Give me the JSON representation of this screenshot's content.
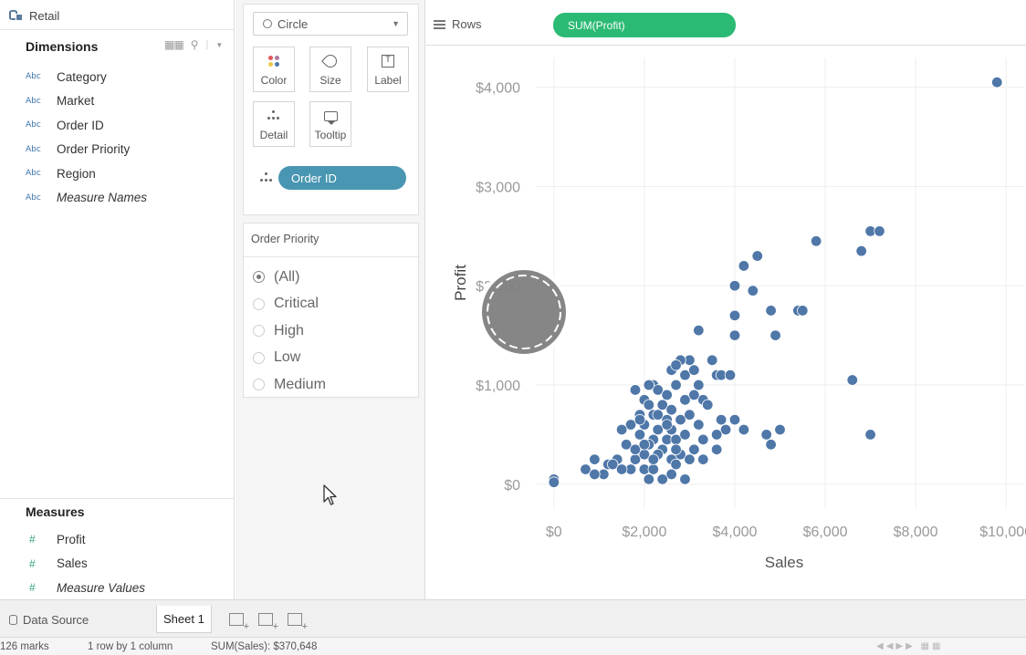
{
  "data_pane": {
    "datasource": "Retail",
    "dimensions_title": "Dimensions",
    "dimensions": [
      {
        "type": "Abc",
        "name": "Category",
        "italic": false
      },
      {
        "type": "Abc",
        "name": "Market",
        "italic": false
      },
      {
        "type": "Abc",
        "name": "Order ID",
        "italic": false
      },
      {
        "type": "Abc",
        "name": "Order Priority",
        "italic": false
      },
      {
        "type": "Abc",
        "name": "Region",
        "italic": false
      },
      {
        "type": "Abc",
        "name": "Measure Names",
        "italic": true
      }
    ],
    "measures_title": "Measures",
    "measures": [
      {
        "type": "#",
        "name": "Profit",
        "italic": false
      },
      {
        "type": "#",
        "name": "Sales",
        "italic": false
      },
      {
        "type": "#",
        "name": "Measure Values",
        "italic": true
      }
    ]
  },
  "marks": {
    "mark_type": "Circle",
    "buttons": {
      "color": "Color",
      "size": "Size",
      "label": "Label",
      "detail": "Detail",
      "tooltip": "Tooltip"
    },
    "label_glyph": "T",
    "detail_pill": "Order ID",
    "colors": {
      "pill_detail": "#4996b2",
      "dot_a": "#e15759",
      "dot_b": "#b07aa1",
      "dot_c": "#edc948",
      "dot_d": "#4e79a7"
    }
  },
  "filter": {
    "title": "Order Priority",
    "options": [
      {
        "label": "(All)",
        "selected": true
      },
      {
        "label": "Critical",
        "selected": false
      },
      {
        "label": "High",
        "selected": false
      },
      {
        "label": "Low",
        "selected": false
      },
      {
        "label": "Medium",
        "selected": false
      }
    ]
  },
  "shelf": {
    "rows_label": "Rows",
    "rows_pill": "SUM(Profit)",
    "pill_color": "#2bba73"
  },
  "chart_data": {
    "type": "scatter",
    "xlabel": "Sales",
    "ylabel": "Profit",
    "xlim": [
      -400,
      10400
    ],
    "ylim": [
      -250,
      4300
    ],
    "x_ticks": [
      0,
      2000,
      4000,
      6000,
      8000,
      10000
    ],
    "x_tick_labels": [
      "$0",
      "$2,000",
      "$4,000",
      "$6,000",
      "$8,000",
      "$10,000"
    ],
    "y_ticks": [
      0,
      1000,
      2000,
      3000,
      4000
    ],
    "y_tick_labels": [
      "$0",
      "$1,000",
      "$2,000",
      "$3,000",
      "$4,000"
    ],
    "grid": true,
    "point_color": "#4f77a8",
    "points": [
      [
        9800,
        4050
      ],
      [
        7000,
        2550
      ],
      [
        7200,
        2550
      ],
      [
        5800,
        2450
      ],
      [
        6800,
        2350
      ],
      [
        4500,
        2300
      ],
      [
        4200,
        2200
      ],
      [
        4000,
        2000
      ],
      [
        4400,
        1950
      ],
      [
        5400,
        1750
      ],
      [
        5500,
        1750
      ],
      [
        4800,
        1750
      ],
      [
        4000,
        1700
      ],
      [
        3200,
        1550
      ],
      [
        4000,
        1500
      ],
      [
        4900,
        1500
      ],
      [
        3000,
        1250
      ],
      [
        2800,
        1250
      ],
      [
        3500,
        1250
      ],
      [
        3600,
        1100
      ],
      [
        3700,
        1100
      ],
      [
        3900,
        1100
      ],
      [
        6600,
        1050
      ],
      [
        2900,
        1100
      ],
      [
        3100,
        1150
      ],
      [
        2600,
        1150
      ],
      [
        2700,
        1000
      ],
      [
        3200,
        1000
      ],
      [
        3300,
        850
      ],
      [
        2200,
        1000
      ],
      [
        2300,
        950
      ],
      [
        1800,
        950
      ],
      [
        2500,
        900
      ],
      [
        2000,
        850
      ],
      [
        2900,
        850
      ],
      [
        2100,
        800
      ],
      [
        2400,
        800
      ],
      [
        2600,
        750
      ],
      [
        1900,
        700
      ],
      [
        2200,
        700
      ],
      [
        2500,
        650
      ],
      [
        2800,
        650
      ],
      [
        3000,
        700
      ],
      [
        3700,
        650
      ],
      [
        4000,
        650
      ],
      [
        3800,
        550
      ],
      [
        4200,
        550
      ],
      [
        1700,
        600
      ],
      [
        2000,
        600
      ],
      [
        2300,
        550
      ],
      [
        2600,
        550
      ],
      [
        3200,
        600
      ],
      [
        3600,
        500
      ],
      [
        4700,
        500
      ],
      [
        5000,
        550
      ],
      [
        7000,
        500
      ],
      [
        1500,
        550
      ],
      [
        1900,
        500
      ],
      [
        2200,
        450
      ],
      [
        2500,
        450
      ],
      [
        2700,
        450
      ],
      [
        2900,
        500
      ],
      [
        3300,
        450
      ],
      [
        1600,
        400
      ],
      [
        2100,
        400
      ],
      [
        2400,
        350
      ],
      [
        2800,
        300
      ],
      [
        3100,
        350
      ],
      [
        3600,
        350
      ],
      [
        4800,
        400
      ],
      [
        1400,
        250
      ],
      [
        1800,
        250
      ],
      [
        2000,
        300
      ],
      [
        2300,
        300
      ],
      [
        2600,
        250
      ],
      [
        3000,
        250
      ],
      [
        3300,
        250
      ],
      [
        1200,
        200
      ],
      [
        1700,
        150
      ],
      [
        2000,
        150
      ],
      [
        2200,
        150
      ],
      [
        2600,
        100
      ],
      [
        900,
        250
      ],
      [
        1100,
        100
      ],
      [
        2400,
        50
      ],
      [
        2900,
        50
      ],
      [
        700,
        150
      ],
      [
        900,
        100
      ],
      [
        1300,
        200
      ],
      [
        1500,
        150
      ],
      [
        2100,
        50
      ],
      [
        2700,
        200
      ],
      [
        0,
        50
      ],
      [
        0,
        20
      ],
      [
        1800,
        350
      ],
      [
        2300,
        700
      ],
      [
        2000,
        400
      ],
      [
        3400,
        800
      ],
      [
        2700,
        1200
      ],
      [
        2100,
        1000
      ],
      [
        2200,
        250
      ],
      [
        2500,
        600
      ],
      [
        1900,
        650
      ],
      [
        2700,
        350
      ],
      [
        3100,
        900
      ]
    ]
  },
  "tabs": {
    "data_source": "Data Source",
    "sheet": "Sheet 1"
  },
  "status": {
    "marks": "126 marks",
    "dims": "1 row by 1 column",
    "sum": "SUM(Sales): $370,648"
  }
}
